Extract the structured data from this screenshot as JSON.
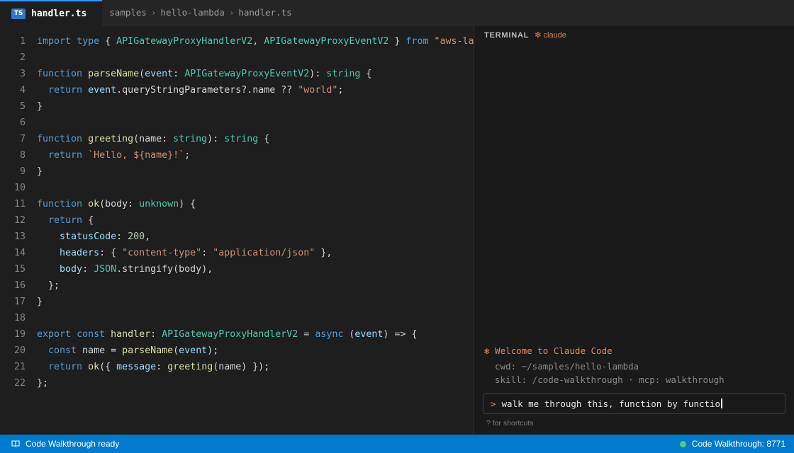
{
  "tab": {
    "badge": "TS",
    "label": "handler.ts"
  },
  "breadcrumb": [
    "samples",
    "hello-lambda",
    "handler.ts"
  ],
  "editor": {
    "lines": [
      {
        "n": "1",
        "tokens": [
          [
            "k",
            "import"
          ],
          [
            "p",
            " "
          ],
          [
            "k",
            "type"
          ],
          [
            "p",
            " { "
          ],
          [
            "t",
            "APIGatewayProxyHandlerV2"
          ],
          [
            "p",
            ", "
          ],
          [
            "t",
            "APIGatewayProxyEventV2"
          ],
          [
            "p",
            " } "
          ],
          [
            "k",
            "from"
          ],
          [
            "p",
            " "
          ],
          [
            "s",
            "\"aws-lambda\""
          ],
          [
            "p",
            ";"
          ]
        ]
      },
      {
        "n": "2",
        "tokens": []
      },
      {
        "n": "3",
        "tokens": [
          [
            "k",
            "function"
          ],
          [
            "p",
            " "
          ],
          [
            "f",
            "parseName"
          ],
          [
            "p",
            "("
          ],
          [
            "v",
            "event"
          ],
          [
            "p",
            ": "
          ],
          [
            "t",
            "APIGatewayProxyEventV2"
          ],
          [
            "p",
            "): "
          ],
          [
            "t",
            "string"
          ],
          [
            "p",
            " {"
          ]
        ]
      },
      {
        "n": "4",
        "tokens": [
          [
            "p",
            "  "
          ],
          [
            "k",
            "return"
          ],
          [
            "p",
            " "
          ],
          [
            "v",
            "event"
          ],
          [
            "p",
            ".queryStringParameters?.name ?? "
          ],
          [
            "s",
            "\"world\""
          ],
          [
            "p",
            ";"
          ]
        ]
      },
      {
        "n": "5",
        "tokens": [
          [
            "p",
            "}"
          ]
        ]
      },
      {
        "n": "6",
        "tokens": []
      },
      {
        "n": "7",
        "tokens": [
          [
            "k",
            "function"
          ],
          [
            "p",
            " "
          ],
          [
            "f",
            "greeting"
          ],
          [
            "p",
            "(name: "
          ],
          [
            "t",
            "string"
          ],
          [
            "p",
            "): "
          ],
          [
            "t",
            "string"
          ],
          [
            "p",
            " {"
          ]
        ]
      },
      {
        "n": "8",
        "tokens": [
          [
            "p",
            "  "
          ],
          [
            "k",
            "return"
          ],
          [
            "p",
            " "
          ],
          [
            "s",
            "`Hello, ${name}!`"
          ],
          [
            "p",
            ";"
          ]
        ]
      },
      {
        "n": "9",
        "tokens": [
          [
            "p",
            "}"
          ]
        ]
      },
      {
        "n": "10",
        "tokens": []
      },
      {
        "n": "11",
        "tokens": [
          [
            "k",
            "function"
          ],
          [
            "p",
            " "
          ],
          [
            "f",
            "ok"
          ],
          [
            "p",
            "(body: "
          ],
          [
            "t",
            "unknown"
          ],
          [
            "p",
            ") {"
          ]
        ]
      },
      {
        "n": "12",
        "tokens": [
          [
            "p",
            "  "
          ],
          [
            "k",
            "return"
          ],
          [
            "p",
            " {"
          ]
        ]
      },
      {
        "n": "13",
        "tokens": [
          [
            "p",
            "    "
          ],
          [
            "v",
            "statusCode"
          ],
          [
            "p",
            ": "
          ],
          [
            "n",
            "200"
          ],
          [
            "p",
            ","
          ]
        ]
      },
      {
        "n": "14",
        "tokens": [
          [
            "p",
            "    "
          ],
          [
            "v",
            "headers"
          ],
          [
            "p",
            ": { "
          ],
          [
            "s",
            "\"content-type\""
          ],
          [
            "p",
            ": "
          ],
          [
            "s",
            "\"application/json\""
          ],
          [
            "p",
            " },"
          ]
        ]
      },
      {
        "n": "15",
        "tokens": [
          [
            "p",
            "    "
          ],
          [
            "v",
            "body"
          ],
          [
            "p",
            ": "
          ],
          [
            "t",
            "JSON"
          ],
          [
            "p",
            ".stringify(body),"
          ]
        ]
      },
      {
        "n": "16",
        "tokens": [
          [
            "p",
            "  };"
          ]
        ]
      },
      {
        "n": "17",
        "tokens": [
          [
            "p",
            "}"
          ]
        ]
      },
      {
        "n": "18",
        "tokens": []
      },
      {
        "n": "19",
        "tokens": [
          [
            "k",
            "export"
          ],
          [
            "p",
            " "
          ],
          [
            "k",
            "const"
          ],
          [
            "p",
            " "
          ],
          [
            "f",
            "handler"
          ],
          [
            "p",
            ": "
          ],
          [
            "t",
            "APIGatewayProxyHandlerV2"
          ],
          [
            "p",
            " = "
          ],
          [
            "k",
            "async"
          ],
          [
            "p",
            " ("
          ],
          [
            "v",
            "event"
          ],
          [
            "p",
            ") => {"
          ]
        ]
      },
      {
        "n": "20",
        "tokens": [
          [
            "p",
            "  "
          ],
          [
            "k",
            "const"
          ],
          [
            "p",
            " name = "
          ],
          [
            "f",
            "parseName"
          ],
          [
            "p",
            "("
          ],
          [
            "v",
            "event"
          ],
          [
            "p",
            ");"
          ]
        ]
      },
      {
        "n": "21",
        "tokens": [
          [
            "p",
            "  "
          ],
          [
            "k",
            "return"
          ],
          [
            "p",
            " "
          ],
          [
            "f",
            "ok"
          ],
          [
            "p",
            "({ "
          ],
          [
            "v",
            "message"
          ],
          [
            "p",
            ": "
          ],
          [
            "f",
            "greeting"
          ],
          [
            "p",
            "(name) });"
          ]
        ]
      },
      {
        "n": "22",
        "tokens": [
          [
            "p",
            "};"
          ]
        ]
      }
    ]
  },
  "terminal": {
    "title": "TERMINAL",
    "tag": "✻ claude",
    "welcome": "✻ Welcome to Claude Code",
    "cwd": "cwd: ~/samples/hello-lambda",
    "skill": "skill: /code-walkthrough · mcp: walkthrough",
    "prompt_symbol": ">",
    "prompt_text": "walk me through this, function by functio",
    "shortcuts": "? for shortcuts"
  },
  "status": {
    "left_label": "Code Walkthrough ready",
    "right_label": "Code Walkthrough: 8771",
    "dot_color": "#4cd07d",
    "bar_color": "#007acc"
  }
}
